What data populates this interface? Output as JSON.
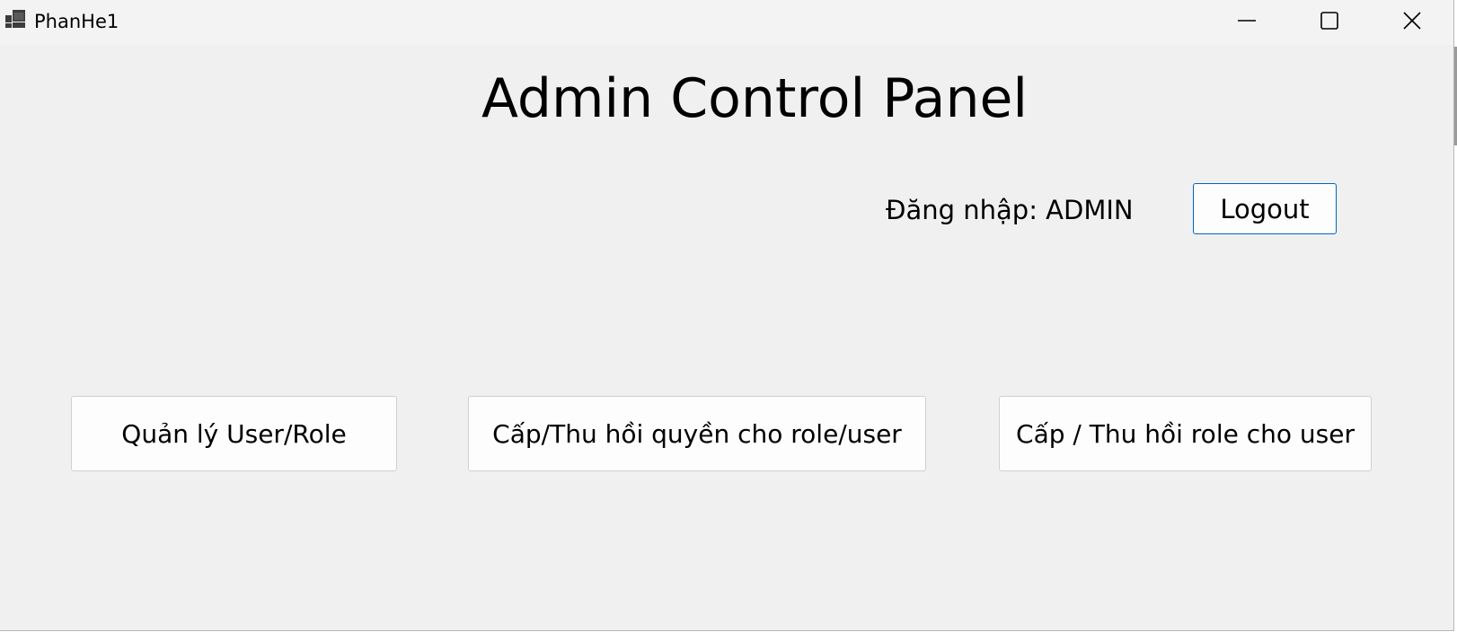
{
  "window": {
    "title": "PhanHe1",
    "app_icon": "app-window-icon",
    "controls": {
      "minimize_icon": "minimize-icon",
      "maximize_icon": "maximize-icon",
      "close_icon": "close-icon"
    }
  },
  "main": {
    "title": "Admin Control Panel",
    "login_status": "Đăng nhập: ADMIN",
    "logout_label": "Logout",
    "actions": [
      {
        "label": "Quản lý User/Role"
      },
      {
        "label": "Cấp/Thu hồi quyền cho role/user"
      },
      {
        "label": "Cấp / Thu hồi role cho user"
      }
    ]
  },
  "colors": {
    "window_background": "#f0f0f0",
    "titlebar_background": "#f3f3f3",
    "button_background": "#fdfdfd",
    "focus_border": "#0067c0",
    "button_border": "#d0d0d0"
  }
}
